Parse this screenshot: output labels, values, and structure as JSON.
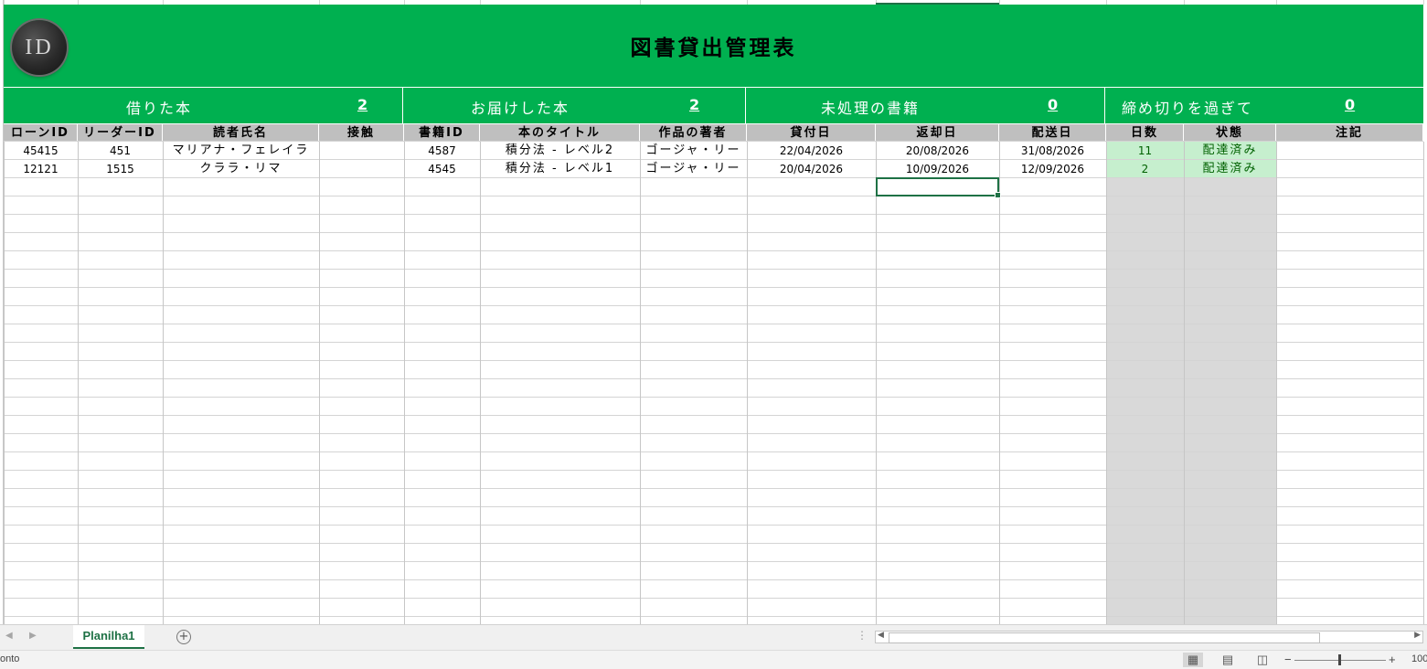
{
  "title": "図書貸出管理表",
  "logo_text": "ID",
  "kpis": [
    {
      "label": "借りた本",
      "value": "2"
    },
    {
      "label": "お届けした本",
      "value": "2"
    },
    {
      "label": "未処理の書籍",
      "value": "0"
    },
    {
      "label": "締め切りを過ぎて",
      "value": "0"
    }
  ],
  "columns": [
    "ローンID",
    "リーダーID",
    "読者氏名",
    "接触",
    "書籍ID",
    "本のタイトル",
    "作品の著者",
    "貸付日",
    "返却日",
    "配送日",
    "日数",
    "状態",
    "注記"
  ],
  "rows": [
    [
      "45415",
      "451",
      "マリアナ・フェレイラ",
      "",
      "4587",
      "積分法 - レベル2",
      "ゴージャ・リー",
      "22/04/2026",
      "20/08/2026",
      "31/08/2026",
      "11",
      "配達済み",
      ""
    ],
    [
      "12121",
      "1515",
      "クララ・リマ",
      "",
      "4545",
      "積分法 - レベル1",
      "ゴージャ・リー",
      "20/04/2026",
      "10/09/2026",
      "12/09/2026",
      "2",
      "配達済み",
      ""
    ]
  ],
  "sheet_tab": "Planilha1",
  "status_text": "onto",
  "zoom": "100",
  "colors": {
    "banner": "#00b050",
    "header_gray": "#bfbfbf",
    "status_green_bg": "#c6efce",
    "status_green_text": "#006100",
    "accent": "#1e7145"
  }
}
